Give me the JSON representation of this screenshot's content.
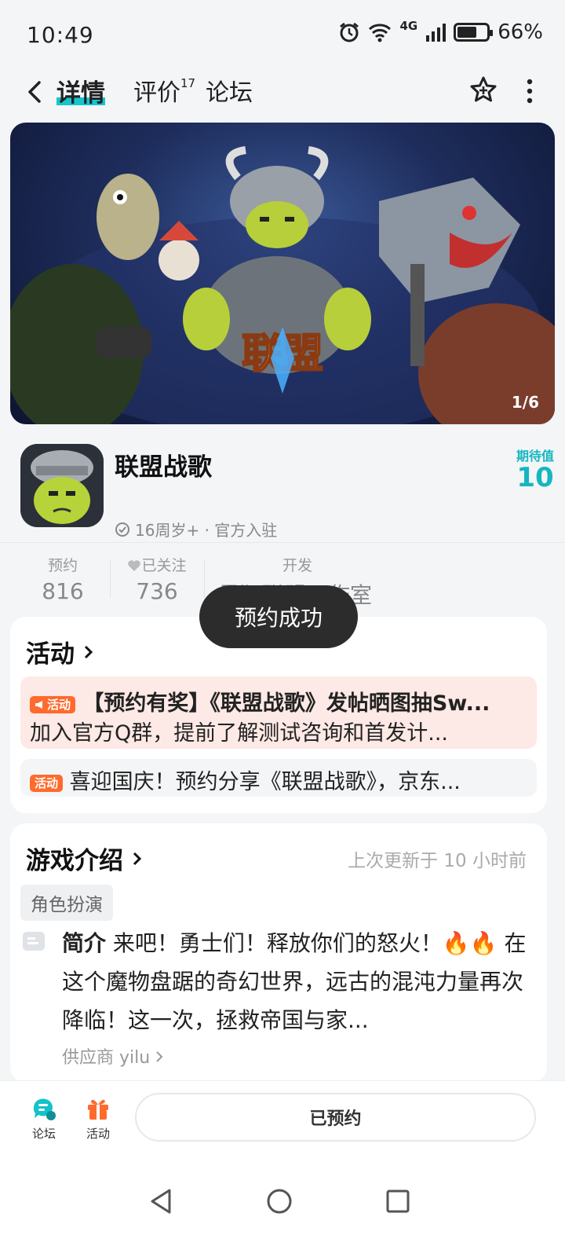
{
  "status_bar": {
    "time": "10:49",
    "network": "4G",
    "battery": "66%"
  },
  "nav": {
    "tab_active": "详情",
    "tab_review": "评价",
    "review_count": "17",
    "tab_forum": "论坛"
  },
  "banner": {
    "counter": "1/6",
    "logo_text": "联盟战歌"
  },
  "app": {
    "name": "联盟战歌",
    "meta": "16周岁+ · 官方入驻",
    "expect_label": "期待值",
    "expect_value": "10"
  },
  "stats": {
    "reserve_label": "预约",
    "reserve_value": "816",
    "follow_label": "已关注",
    "follow_value": "736",
    "dev_label": "开发",
    "dev_value": "星狸联盟工作室"
  },
  "toast": "预约成功",
  "activity": {
    "title": "活动",
    "items": [
      {
        "tag": "活动",
        "title": "【预约有奖】《联盟战歌》发帖晒图抽Sw...",
        "desc": "加入官方Q群，提前了解测试咨询和首发计..."
      },
      {
        "tag": "活动",
        "title": "喜迎国庆！预约分享《联盟战歌》，京东..."
      }
    ]
  },
  "intro": {
    "title": "游戏介绍",
    "updated": "上次更新于 10 小时前",
    "genre": "角色扮演",
    "label": "简介",
    "text": "来吧！勇士们！释放你们的怒火！🔥🔥 在这个魔物盘踞的奇幻世界，远古的混沌力量再次降临！这一次，拯救帝国与家...",
    "supplier": "供应商 yilu"
  },
  "bottom": {
    "forum_label": "论坛",
    "activity_label": "活动",
    "reserve_button": "已预约"
  },
  "colors": {
    "accent": "#15c5ce",
    "orange": "#ff6a2d"
  }
}
